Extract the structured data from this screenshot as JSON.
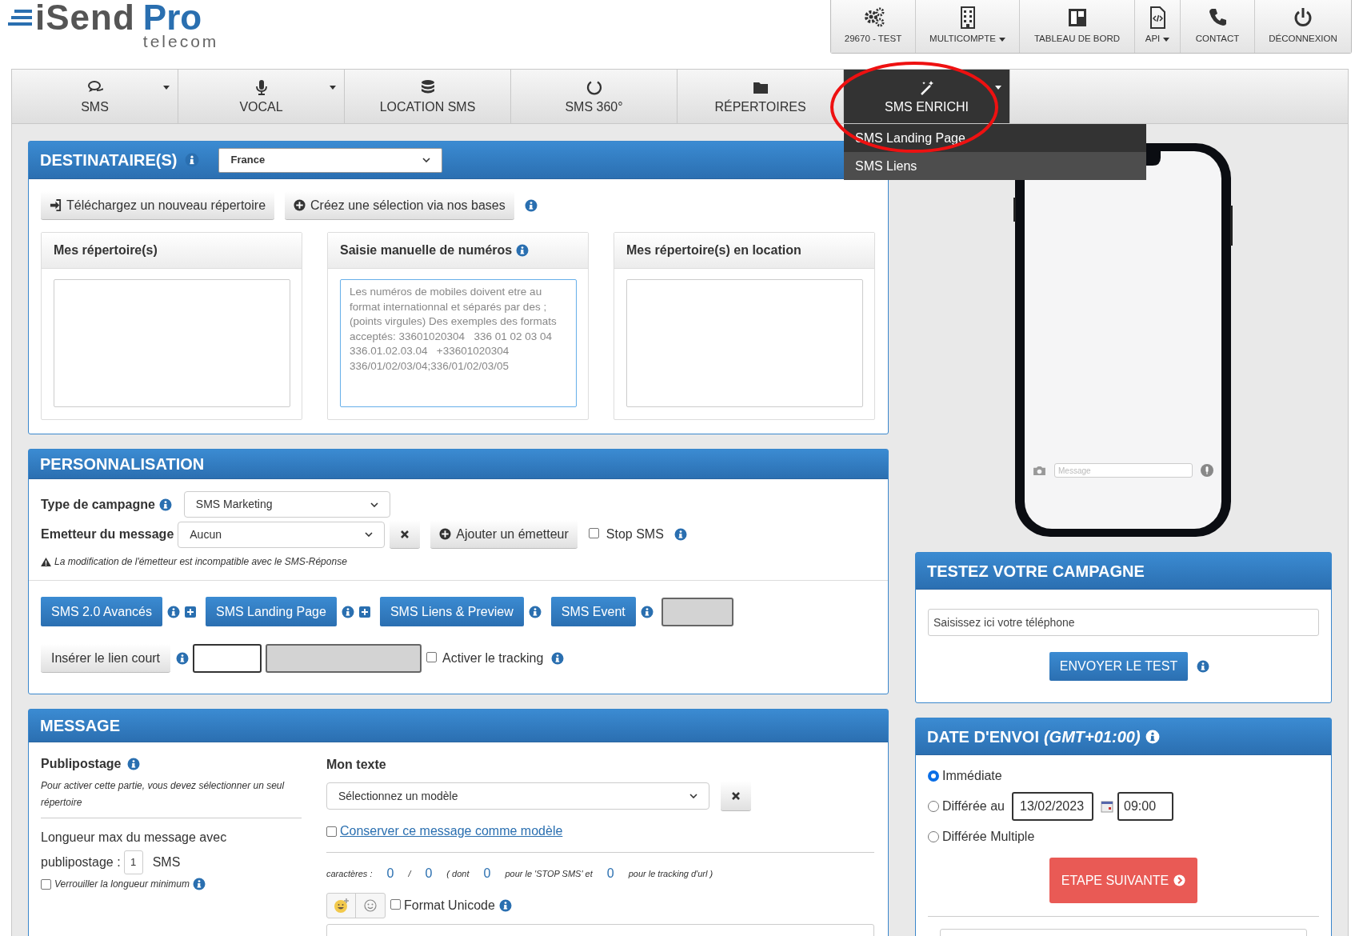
{
  "logo": {
    "word_1": "iSend",
    "word_2": "Pro",
    "tagline": "telecom"
  },
  "top_menu": [
    {
      "label": "29670 - TEST",
      "caret": false
    },
    {
      "label": "MULTICOMPTE",
      "caret": true
    },
    {
      "label": "TABLEAU DE BORD",
      "caret": false
    },
    {
      "label": "API",
      "caret": true
    },
    {
      "label": "CONTACT",
      "caret": false
    },
    {
      "label": "DÉCONNEXION",
      "caret": false
    }
  ],
  "nav_tabs": [
    {
      "label": "SMS",
      "caret": true,
      "selected": false
    },
    {
      "label": "VOCAL",
      "caret": true,
      "selected": false
    },
    {
      "label": "LOCATION SMS",
      "caret": false,
      "selected": false
    },
    {
      "label": "SMS 360°",
      "caret": false,
      "selected": false
    },
    {
      "label": "RÉPERTOIRES",
      "caret": false,
      "selected": false
    },
    {
      "label": "SMS ENRICHI",
      "caret": true,
      "selected": true
    }
  ],
  "dropdown_menu": [
    {
      "label": "SMS Landing Page",
      "highlighted": false
    },
    {
      "label": "SMS Liens",
      "highlighted": true
    }
  ],
  "destinataires": {
    "title": "DESTINATAIRE(S)",
    "country": "France",
    "buttons": [
      {
        "label": "Téléchargez un nouveau répertoire"
      },
      {
        "label": "Créez une sélection via nos bases"
      }
    ],
    "boxes": [
      {
        "title": "Mes répertoire(s)",
        "info": false
      },
      {
        "title": "Saisie manuelle de numéros",
        "info": true,
        "placeholder": "Les numéros de mobiles doivent etre au format internationnal et séparés par des ; (points virgules) Des exemples des formats acceptés: 33601020304   336 01 02 03 04   336.01.02.03.04   +33601020304   336/01/02/03/04;336/01/02/03/05"
      },
      {
        "title": "Mes répertoire(s) en location",
        "info": false
      }
    ]
  },
  "personnalisation": {
    "title": "PERSONNALISATION",
    "campaign_type": {
      "label": "Type de campagne",
      "value": "SMS Marketing"
    },
    "sender": {
      "label": "Emetteur du message",
      "value": "Aucun"
    },
    "add_sender": "Ajouter un émetteur",
    "stop_sms": {
      "label": "Stop SMS",
      "checked": false
    },
    "warning": "La modification de l'émetteur est incompatible avec le SMS-Réponse",
    "feature_buttons": [
      {
        "label": "SMS 2.0 Avancés",
        "plus": true
      },
      {
        "label": "SMS Landing Page",
        "plus": true
      },
      {
        "label": "SMS Liens & Preview",
        "plus": false
      },
      {
        "label": "SMS Event",
        "plus": false
      }
    ],
    "short_link_button": "Insérer le lien court",
    "tracking": {
      "label": "Activer le tracking",
      "checked": false
    }
  },
  "message": {
    "title": "MESSAGE",
    "publipostage": {
      "title": "Publipostage",
      "note": "Pour activer cette partie, vous devez sélectionner un seul répertoire",
      "max_label_1": "Longueur max du message avec",
      "max_label_2": "publipostage :",
      "max_value": "1",
      "unit": "SMS",
      "lock": {
        "label": "Verrouiller la longueur minimum",
        "checked": false
      }
    },
    "text": {
      "title": "Mon texte",
      "template": "Sélectionnez un modèle",
      "save": {
        "label": "Conserver ce message comme modèle",
        "checked": false
      },
      "counters": [
        {
          "kind": "label",
          "text": "caractères :"
        },
        {
          "kind": "number",
          "text": "0"
        },
        {
          "kind": "label",
          "text": "/"
        },
        {
          "kind": "number",
          "text": "0"
        },
        {
          "kind": "label",
          "text": "( dont"
        },
        {
          "kind": "number",
          "text": "0"
        },
        {
          "kind": "label",
          "text": "pour le 'STOP SMS' et"
        },
        {
          "kind": "number",
          "text": "0"
        },
        {
          "kind": "label",
          "text": "pour le tracking d'url )"
        }
      ],
      "unicode": {
        "label": "Format Unicode",
        "checked": false
      }
    }
  },
  "phone_preview": {
    "placeholder": "Message"
  },
  "test": {
    "title": "TESTEZ VOTRE CAMPAGNE",
    "placeholder": "Saisissez ici votre téléphone",
    "button": "ENVOYER LE TEST"
  },
  "send_date": {
    "title": "DATE D'ENVOI",
    "timezone": "(GMT+01:00)",
    "options": [
      {
        "label": "Immédiate",
        "selected": true
      },
      {
        "label": "Différée au",
        "selected": false,
        "date": "13/02/2023",
        "time": "09:00"
      },
      {
        "label": "Différée Multiple",
        "selected": false
      }
    ],
    "button": "ETAPE SUIVANTE"
  }
}
